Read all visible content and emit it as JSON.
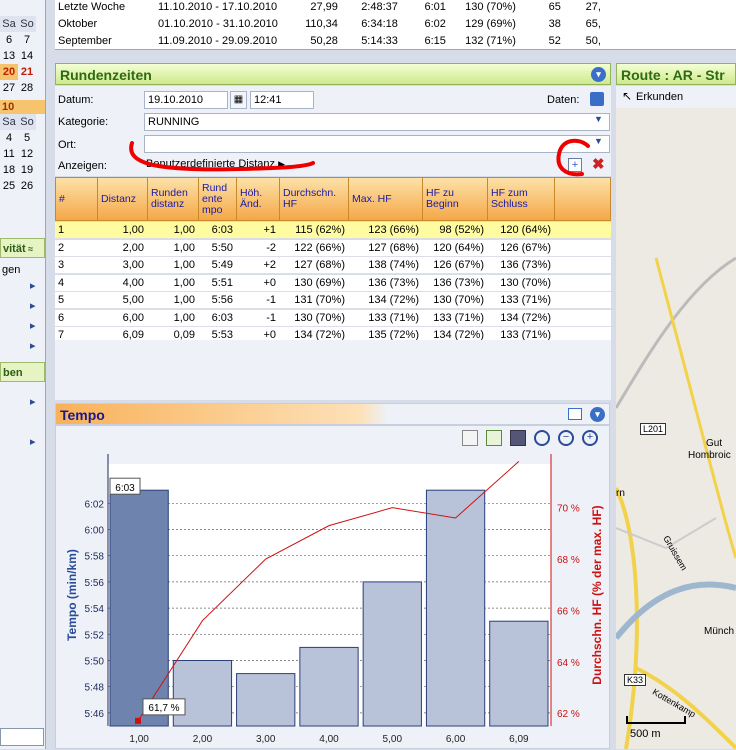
{
  "summary_rows": [
    [
      "Letzte Woche",
      "11.10.2010 - 17.10.2010",
      "27,99",
      "2:48:37",
      "6:01",
      "130 (70%)",
      "65",
      "27,"
    ],
    [
      "Oktober",
      "01.10.2010 - 31.10.2010",
      "110,34",
      "6:34:18",
      "6:02",
      "129 (69%)",
      "38",
      "65,"
    ],
    [
      "September",
      "11.09.2010 - 29.09.2010",
      "50,28",
      "5:14:33",
      "6:15",
      "132 (71%)",
      "52",
      "50,"
    ]
  ],
  "left_calendar": {
    "top_rows": [
      [
        "",
        ""
      ],
      [
        "Sa",
        "So"
      ],
      [
        "6",
        "7"
      ],
      [
        "13",
        "14"
      ],
      [
        "20",
        "21"
      ],
      [
        "27",
        "28"
      ]
    ],
    "month2_label": "10",
    "bottom_rows": [
      [
        "Sa",
        "So"
      ],
      [
        "4",
        "5"
      ],
      [
        "11",
        "12"
      ],
      [
        "18",
        "19"
      ],
      [
        "25",
        "26"
      ]
    ],
    "box1": "vität",
    "box1_item": "gen",
    "box2": "ben"
  },
  "laps_panel": {
    "title": "Rundenzeiten",
    "datum_label": "Datum:",
    "datum_value": "19.10.2010",
    "time_value": "12:41",
    "daten_label": "Daten:",
    "kategorie_label": "Kategorie:",
    "kategorie_value": "RUNNING",
    "ort_label": "Ort:",
    "ort_value": "",
    "anzeigen_label": "Anzeigen:",
    "anzeigen_value": "Benutzerdefinierte Distanz"
  },
  "laps_table": {
    "headers": [
      "#",
      "Distanz",
      "Runden distanz",
      "Rund ente mpo",
      "Höh. Änd.",
      "Durchschn. HF",
      "Max. HF",
      "HF zu Beginn",
      "HF zum Schluss"
    ],
    "rows": [
      [
        "1",
        "1,00",
        "1,00",
        "6:03",
        "+1",
        "115 (62%)",
        "123 (66%)",
        "98 (52%)",
        "120 (64%)"
      ],
      [
        "2",
        "2,00",
        "1,00",
        "5:50",
        "-2",
        "122 (66%)",
        "127 (68%)",
        "120 (64%)",
        "126 (67%)"
      ],
      [
        "3",
        "3,00",
        "1,00",
        "5:49",
        "+2",
        "127 (68%)",
        "138 (74%)",
        "126 (67%)",
        "136 (73%)"
      ],
      [
        "4",
        "4,00",
        "1,00",
        "5:51",
        "+0",
        "130 (69%)",
        "136 (73%)",
        "136 (73%)",
        "130 (70%)"
      ],
      [
        "5",
        "5,00",
        "1,00",
        "5:56",
        "-1",
        "131 (70%)",
        "134 (72%)",
        "130 (70%)",
        "133 (71%)"
      ],
      [
        "6",
        "6,00",
        "1,00",
        "6:03",
        "-1",
        "130 (70%)",
        "133 (71%)",
        "133 (71%)",
        "134 (72%)"
      ],
      [
        "7",
        "6,09",
        "0,09",
        "5:53",
        "+0",
        "134 (72%)",
        "135 (72%)",
        "134 (72%)",
        "133 (71%)"
      ]
    ]
  },
  "tempo_panel": {
    "title": "Tempo"
  },
  "chart_data": {
    "type": "bar",
    "x": [
      "1,00",
      "2,00",
      "3,00",
      "4,00",
      "5,00",
      "6,00",
      "6,09"
    ],
    "bar_series": {
      "ylabel": "Tempo (min/km)",
      "pace_seconds": [
        363,
        350,
        349,
        351,
        356,
        363,
        353
      ],
      "yticks": [
        "5:46",
        "5:48",
        "5:50",
        "5:52",
        "5:54",
        "5:56",
        "5:58",
        "6:00",
        "6:02"
      ],
      "ylim_seconds": [
        345,
        365
      ]
    },
    "line_series": {
      "ylabel": "Durchschn. HF (% der max. HF)",
      "values": [
        61.7,
        65.6,
        68.0,
        69.3,
        70.0,
        69.6,
        71.8
      ],
      "yticks": [
        "62 %",
        "64 %",
        "66 %",
        "68 %",
        "70 %"
      ],
      "ylim": [
        61.5,
        71.7
      ],
      "color": "#cc1111"
    },
    "tooltip_bar": "6:03",
    "tooltip_line": "61,7 %",
    "bar_color": "#b8c3da",
    "selected_bar_color": "#6e83ad"
  },
  "map_panel": {
    "title": "Route : AR - Str",
    "explore_label": "Erkunden",
    "labels": {
      "road1": "L201",
      "road2": "K33",
      "place1": "Gut",
      "place2": "Hombroic",
      "place3": "Gruissem",
      "place4": "Münch",
      "place5": "Kottenkamp",
      "place6": "rn",
      "scale": "500 m"
    }
  }
}
